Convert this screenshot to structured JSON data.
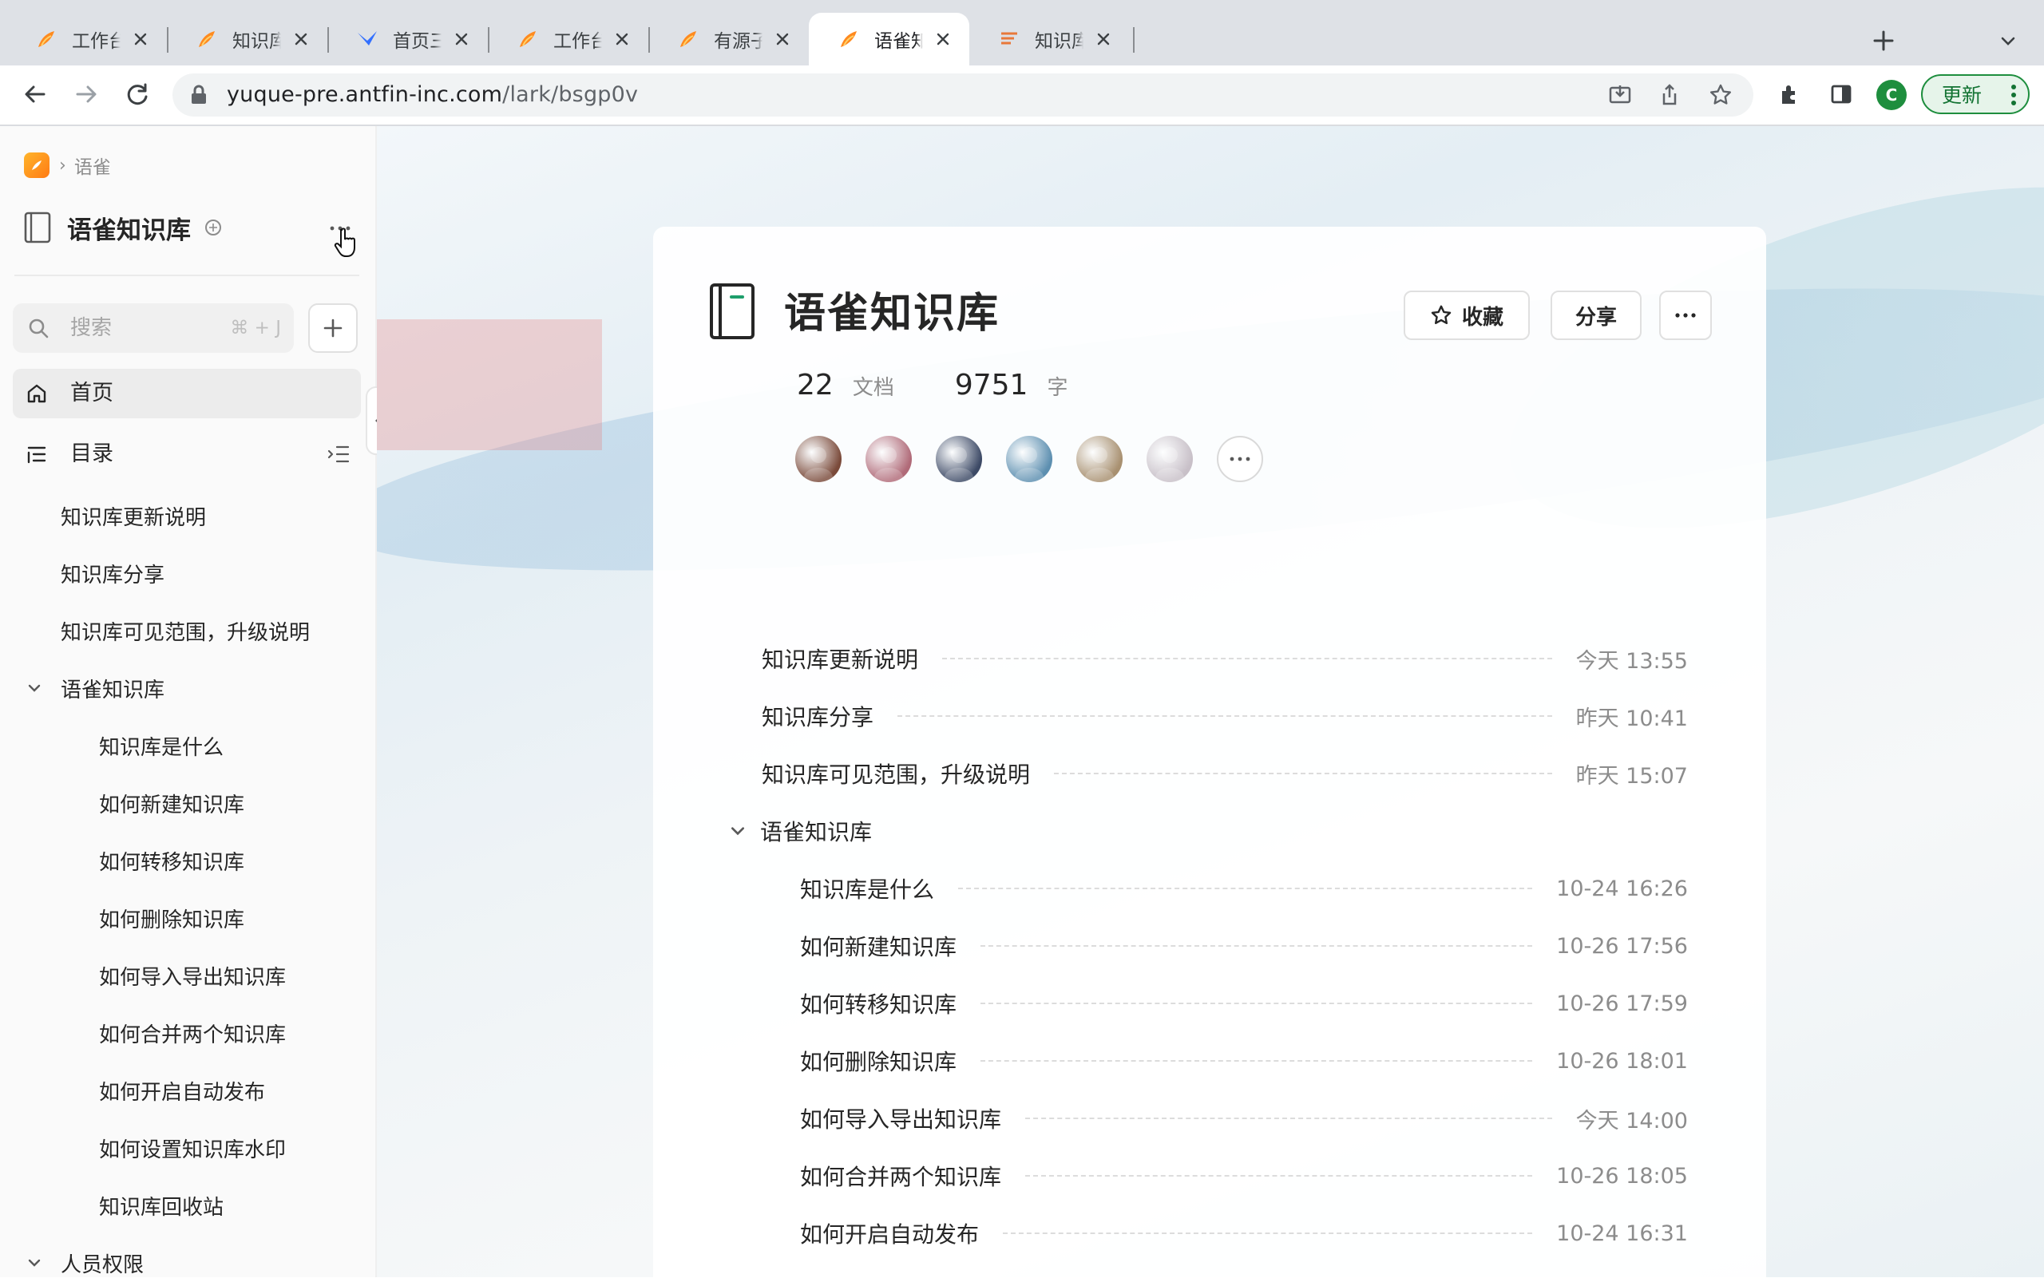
{
  "browser": {
    "tabs": [
      {
        "title": "工作台 · 蚂蚁语雀",
        "favicon": "yuque-icon",
        "active": false
      },
      {
        "title": "知识库编辑权限测试",
        "favicon": "yuque-icon",
        "active": false
      },
      {
        "title": "首页三个点逻辑加",
        "favicon": "lark-bird-icon",
        "active": false
      },
      {
        "title": "工作台 · 蚂蚁语雀",
        "favicon": "yuque-icon",
        "active": false
      },
      {
        "title": "有源子的团队 · 蚂蚁",
        "favicon": "yuque-icon",
        "active": false
      },
      {
        "title": "语雀知识库",
        "favicon": "yuque-icon",
        "active": true
      },
      {
        "title": "知识库更新说明 · 语",
        "favicon": "doc-icon",
        "active": false
      }
    ],
    "url_host": "yuque-pre.antfin-inc.com",
    "url_path": "/lark/bsgp0v",
    "profile_initial": "C",
    "update_label": "更新"
  },
  "sidebar": {
    "breadcrumb": "语雀",
    "kb_title": "语雀知识库",
    "search_placeholder": "搜索",
    "search_shortcut": "⌘ + J",
    "nav": {
      "home": "首页",
      "toc": "目录"
    },
    "toc": [
      {
        "label": "知识库更新说明",
        "level": 0
      },
      {
        "label": "知识库分享",
        "level": 0
      },
      {
        "label": "知识库可见范围，升级说明",
        "level": 0
      },
      {
        "label": "语雀知识库",
        "level": 0,
        "group": true
      },
      {
        "label": "知识库是什么",
        "level": 1
      },
      {
        "label": "如何新建知识库",
        "level": 1
      },
      {
        "label": "如何转移知识库",
        "level": 1
      },
      {
        "label": "如何删除知识库",
        "level": 1
      },
      {
        "label": "如何导入导出知识库",
        "level": 1
      },
      {
        "label": "如何合并两个知识库",
        "level": 1
      },
      {
        "label": "如何开启自动发布",
        "level": 1
      },
      {
        "label": "如何设置知识库水印",
        "level": 1
      },
      {
        "label": "知识库回收站",
        "level": 1
      },
      {
        "label": "人员权限",
        "level": 0,
        "group": true
      }
    ]
  },
  "main": {
    "title": "语雀知识库",
    "star_label": "收藏",
    "share_label": "分享",
    "stats": {
      "docs_count": "22",
      "docs_unit": "文档",
      "words_count": "9751",
      "words_unit": "字"
    },
    "members": [
      {
        "name": "member-1",
        "color": "#7a4a3a"
      },
      {
        "name": "member-2",
        "color": "#b06a78"
      },
      {
        "name": "member-3",
        "color": "#3d4a66"
      },
      {
        "name": "member-4",
        "color": "#5d8fb0"
      },
      {
        "name": "member-5",
        "color": "#a89070"
      },
      {
        "name": "member-6",
        "color": "#c8c0c8"
      }
    ],
    "docs": [
      {
        "title": "知识库更新说明",
        "time": "今天 13:55",
        "level": 0
      },
      {
        "title": "知识库分享",
        "time": "昨天 10:41",
        "level": 0
      },
      {
        "title": "知识库可见范围，升级说明",
        "time": "昨天 15:07",
        "level": 0
      },
      {
        "title": "语雀知识库",
        "time": "",
        "level": 0,
        "group": true
      },
      {
        "title": "知识库是什么",
        "time": "10-24 16:26",
        "level": 1
      },
      {
        "title": "如何新建知识库",
        "time": "10-26 17:56",
        "level": 1
      },
      {
        "title": "如何转移知识库",
        "time": "10-26 17:59",
        "level": 1
      },
      {
        "title": "如何删除知识库",
        "time": "10-26 18:01",
        "level": 1
      },
      {
        "title": "如何导入导出知识库",
        "time": "今天 14:00",
        "level": 1
      },
      {
        "title": "如何合并两个知识库",
        "time": "10-26 18:05",
        "level": 1
      },
      {
        "title": "如何开启自动发布",
        "time": "10-24 16:31",
        "level": 1
      }
    ]
  }
}
